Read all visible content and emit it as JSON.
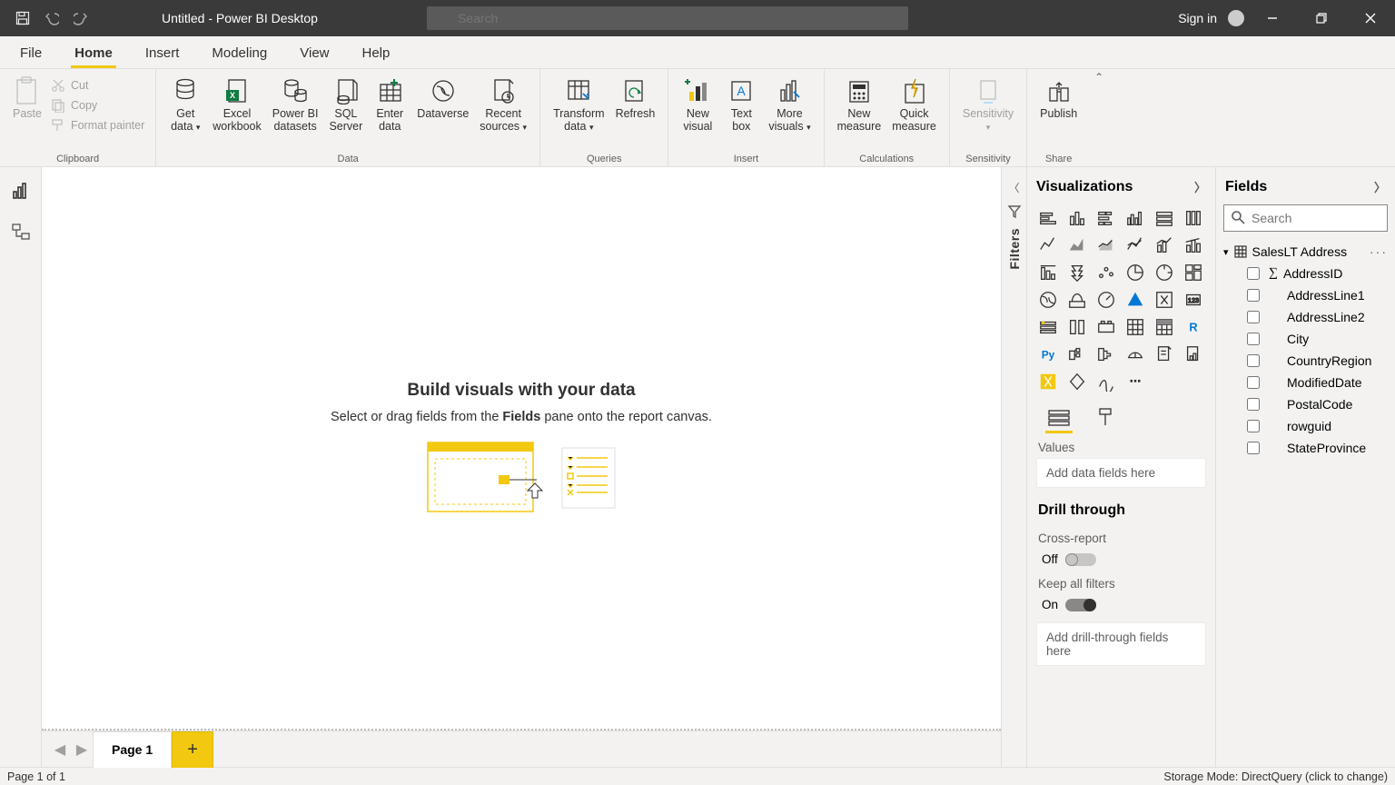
{
  "titlebar": {
    "title": "Untitled - Power BI Desktop",
    "search_placeholder": "Search",
    "signin": "Sign in"
  },
  "menubar": {
    "items": [
      "File",
      "Home",
      "Insert",
      "Modeling",
      "View",
      "Help"
    ],
    "active_index": 1
  },
  "ribbon": {
    "clipboard": {
      "label": "Clipboard",
      "paste": "Paste",
      "cut": "Cut",
      "copy": "Copy",
      "format_painter": "Format painter"
    },
    "data": {
      "label": "Data",
      "get_data": "Get\ndata",
      "excel": "Excel\nworkbook",
      "pbi_datasets": "Power BI\ndatasets",
      "sql_server": "SQL\nServer",
      "enter_data": "Enter\ndata",
      "dataverse": "Dataverse",
      "recent_sources": "Recent\nsources"
    },
    "queries": {
      "label": "Queries",
      "transform": "Transform\ndata",
      "refresh": "Refresh"
    },
    "insert": {
      "label": "Insert",
      "new_visual": "New\nvisual",
      "text_box": "Text\nbox",
      "more_visuals": "More\nvisuals"
    },
    "calculations": {
      "label": "Calculations",
      "new_measure": "New\nmeasure",
      "quick_measure": "Quick\nmeasure"
    },
    "sensitivity": {
      "label": "Sensitivity",
      "btn": "Sensitivity"
    },
    "share": {
      "label": "Share",
      "publish": "Publish"
    }
  },
  "canvas": {
    "heading": "Build visuals with your data",
    "sub_pre": "Select or drag fields from the ",
    "sub_bold": "Fields",
    "sub_post": " pane onto the report canvas."
  },
  "pages": {
    "tab": "Page 1"
  },
  "filters_label": "Filters",
  "vis": {
    "title": "Visualizations",
    "values_label": "Values",
    "values_placeholder": "Add data fields here",
    "drill_title": "Drill through",
    "cross_report": "Cross-report",
    "cross_state": "Off",
    "keep_filters": "Keep all filters",
    "keep_state": "On",
    "drill_placeholder": "Add drill-through fields here"
  },
  "fields": {
    "title": "Fields",
    "search_placeholder": "Search",
    "table": "SalesLT Address",
    "cols": [
      {
        "name": "AddressID",
        "sigma": true
      },
      {
        "name": "AddressLine1",
        "sigma": false
      },
      {
        "name": "AddressLine2",
        "sigma": false
      },
      {
        "name": "City",
        "sigma": false
      },
      {
        "name": "CountryRegion",
        "sigma": false
      },
      {
        "name": "ModifiedDate",
        "sigma": false
      },
      {
        "name": "PostalCode",
        "sigma": false
      },
      {
        "name": "rowguid",
        "sigma": false
      },
      {
        "name": "StateProvince",
        "sigma": false
      }
    ]
  },
  "status": {
    "left": "Page 1 of 1",
    "right": "Storage Mode: DirectQuery (click to change)"
  }
}
